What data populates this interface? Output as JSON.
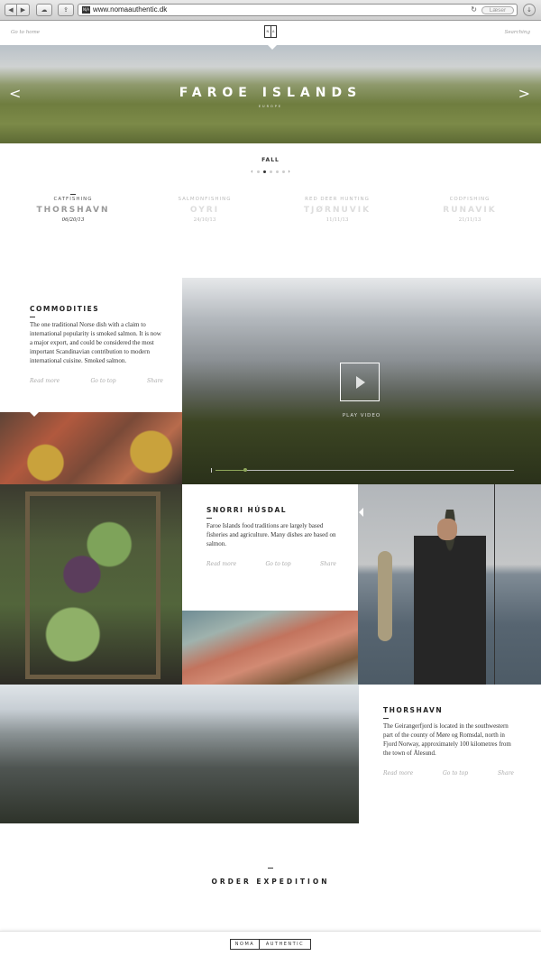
{
  "browser": {
    "url": "www.nomaauthentic.dk",
    "reader_label": "Læser",
    "favicon_text": "N|A"
  },
  "topnav": {
    "go_home": "Go to home",
    "searching": "Searching",
    "logo_left": "N",
    "logo_right": "A"
  },
  "hero": {
    "title": "FAROE ISLANDS",
    "subtitle": "EUROPE",
    "prev": "<",
    "next": ">"
  },
  "season": {
    "label": "FALL",
    "prev": "‹",
    "next": "›"
  },
  "trips": [
    {
      "kind": "CATFISHING",
      "place": "THORSHAVN",
      "date": "06/20/13",
      "active": true
    },
    {
      "kind": "SALMONFISHING",
      "place": "OYRI",
      "date": "24/10/13",
      "active": false
    },
    {
      "kind": "RED DEER HUNTING",
      "place": "TJØRNUVIK",
      "date": "11/11/13",
      "active": false
    },
    {
      "kind": "CODFISHING",
      "place": "RUNAVIK",
      "date": "21/11/13",
      "active": false
    }
  ],
  "commodities": {
    "title": "COMMODITIES",
    "text": "The one traditional Norse dish with a claim to international popularity is smoked salmon. It is now a major export, and could be considered the most important Scandinavian contribution to modern international cuisine. Smoked salmon.",
    "read_more": "Read more",
    "go_top": "Go to top",
    "share": "Share"
  },
  "video": {
    "label": "PLAY VIDEO",
    "progress": 0.1
  },
  "snorri": {
    "title": "SNORRI HÚSDAL",
    "text": "Faroe Islands food traditions are largely based fisheries and agriculture. Many dishes are based on salmon.",
    "read_more": "Read more",
    "go_top": "Go to top",
    "share": "Share"
  },
  "thorshavn": {
    "title": "THORSHAVN",
    "text": "The Geirangerfjord is located in the southwestern part of the county of Møre og Romsdal, north in Fjord Norway, approximately 100 kilometres from the town of Ålesund.",
    "read_more": "Read more",
    "go_top": "Go to top",
    "share": "Share"
  },
  "order": {
    "label": "ORDER EXPEDITION"
  },
  "footer": {
    "logo_left": "NOMA",
    "logo_right": "AUTHENTIC"
  },
  "colors": {
    "accent": "#8fa85b",
    "text": "#222222",
    "muted": "#aaaaaa"
  }
}
